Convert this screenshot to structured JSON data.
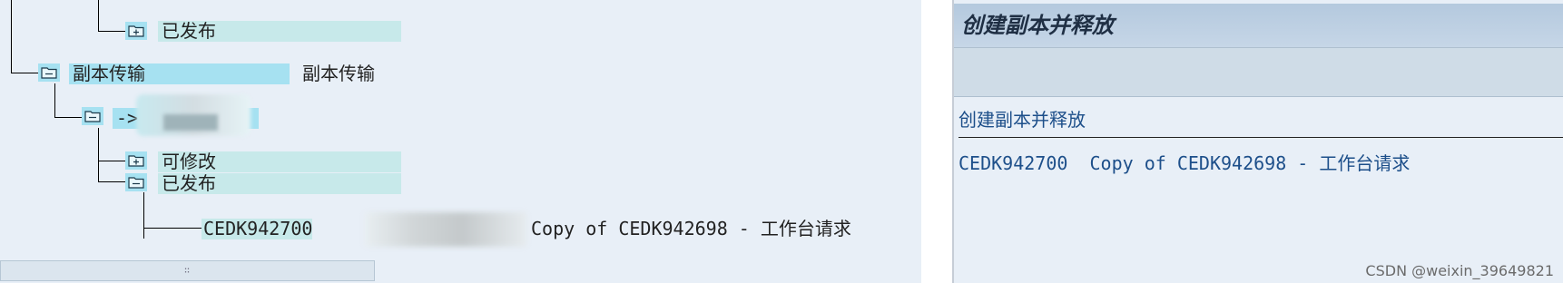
{
  "tree": {
    "released_folder_top": "已发布",
    "copy_transport_node": "副本传输",
    "copy_transport_desc": "副本传输",
    "arrow_prefix": "->",
    "modifiable_folder": "可修改",
    "released_folder": "已发布",
    "request_id": "CEDK942700",
    "request_desc": "Copy of CEDK942698 - 工作台请求"
  },
  "scrollbar": {
    "grip": "∷"
  },
  "detail": {
    "title": "创建副本并释放",
    "section_label": "创建副本并释放",
    "request_id": "CEDK942700",
    "request_desc": "Copy of CEDK942698 - 工作台请求"
  },
  "watermark": "CSDN @weixin_39649821",
  "icons": {
    "folder_released": "folder-released-icon",
    "folder_open": "folder-icon",
    "folder_modifiable": "folder-modifiable-icon"
  },
  "colors": {
    "panel_bg": "#e8eff7",
    "node_highlight": "#a6e1f1",
    "label_teal": "#c7e9ea",
    "detail_text": "#1d4f8a",
    "header_gradient": "#b4c9de"
  }
}
